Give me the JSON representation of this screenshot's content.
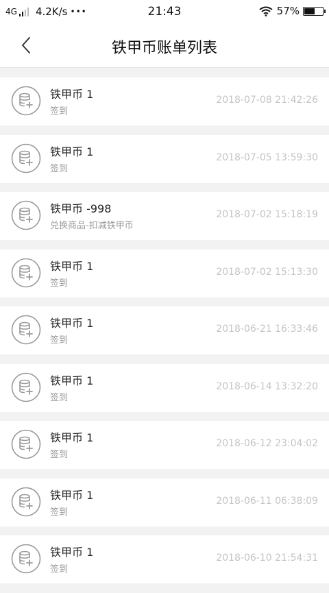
{
  "status_bar": {
    "network": "4G",
    "speed": "4.2K/s",
    "dots": "•••",
    "time": "21:43",
    "battery": "57%"
  },
  "header": {
    "title": "铁甲币账单列表",
    "back_icon": "chevron-left-icon"
  },
  "records": [
    {
      "title": "铁甲币 1",
      "subtitle": "签到",
      "time": "2018-07-08 21:42:26"
    },
    {
      "title": "铁甲币 1",
      "subtitle": "签到",
      "time": "2018-07-05 13:59:30"
    },
    {
      "title": "铁甲币 -998",
      "subtitle": "兑换商品-扣减铁甲币",
      "time": "2018-07-02 15:18:19"
    },
    {
      "title": "铁甲币 1",
      "subtitle": "签到",
      "time": "2018-07-02 15:13:30"
    },
    {
      "title": "铁甲币 1",
      "subtitle": "签到",
      "time": "2018-06-21 16:33:46"
    },
    {
      "title": "铁甲币 1",
      "subtitle": "签到",
      "time": "2018-06-14 13:32:20"
    },
    {
      "title": "铁甲币 1",
      "subtitle": "签到",
      "time": "2018-06-12 23:04:02"
    },
    {
      "title": "铁甲币 1",
      "subtitle": "签到",
      "time": "2018-06-11 06:38:09"
    },
    {
      "title": "铁甲币 1",
      "subtitle": "签到",
      "time": "2018-06-10 21:54:31"
    }
  ],
  "colors": {
    "page_background": "#f2f2f2",
    "card_background": "#ffffff",
    "timestamp": "#c4c4c4",
    "subtitle": "#999999",
    "icon": "#9a9a9a"
  }
}
